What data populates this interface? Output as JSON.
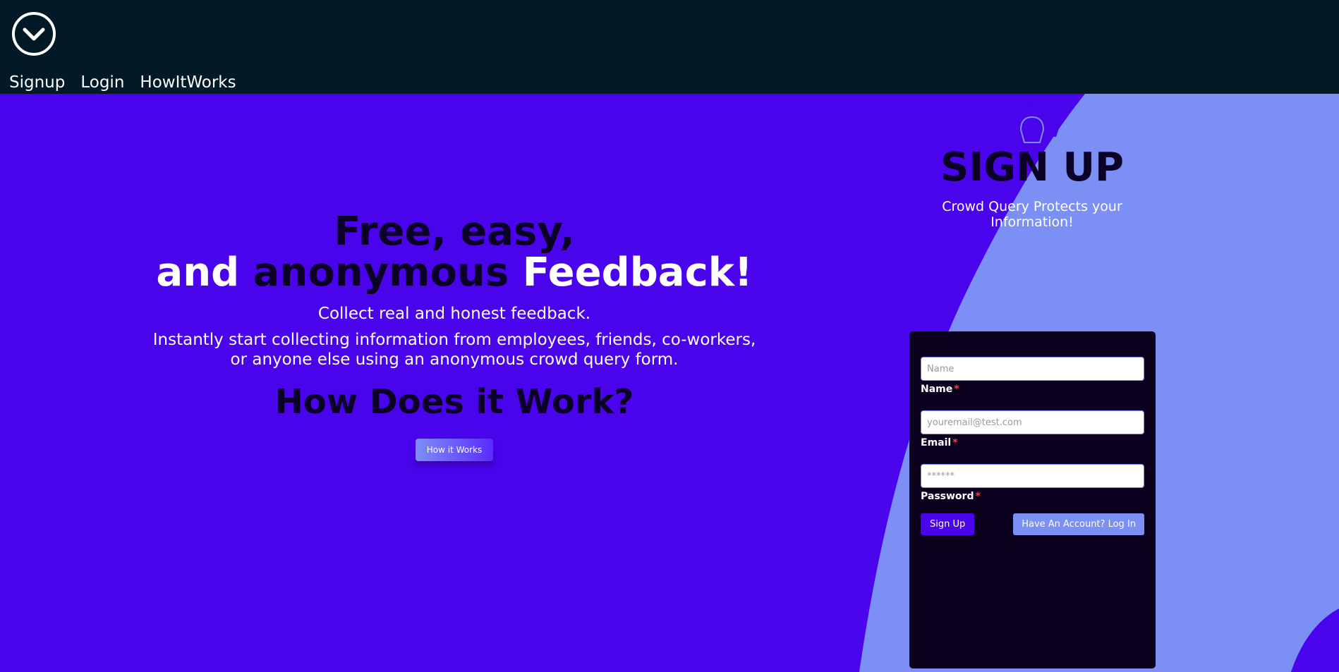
{
  "nav": {
    "items": [
      {
        "label": "Signup"
      },
      {
        "label": "Login"
      },
      {
        "label": "HowItWorks"
      }
    ]
  },
  "hero": {
    "headline_line1": "Free, easy,",
    "headline_line2_part1": "and",
    "headline_line2_part2": "anonymous",
    "headline_line2_part3": "Feedback!",
    "subtitle": "Collect real and honest feedback.",
    "description_line1": "Instantly start collecting information from employees, friends, co-workers,",
    "description_line2": "or anyone else using an anonymous crowd query form.",
    "how_heading": "How Does it Work?",
    "how_button": "How it Works"
  },
  "signup": {
    "title": "SIGN UP",
    "subtitle": "Crowd Query Protects your Information!",
    "fields": {
      "name": {
        "placeholder": "Name",
        "label": "Name"
      },
      "email": {
        "placeholder": "youremail@test.com",
        "label": "Email"
      },
      "password": {
        "placeholder": "******",
        "label": "Password"
      }
    },
    "required_mark": "*",
    "submit_label": "Sign Up",
    "login_label": "Have An Account? Log In"
  },
  "colors": {
    "topbar": "#021a28",
    "hero_bg": "#4a04ec",
    "accent_light": "#7c8ff5",
    "card_bg": "#0c0220",
    "heading_dark": "#0c0126"
  },
  "icons": {
    "logo": "chevron-down-circle-icon",
    "signup": "users-group-icon"
  }
}
